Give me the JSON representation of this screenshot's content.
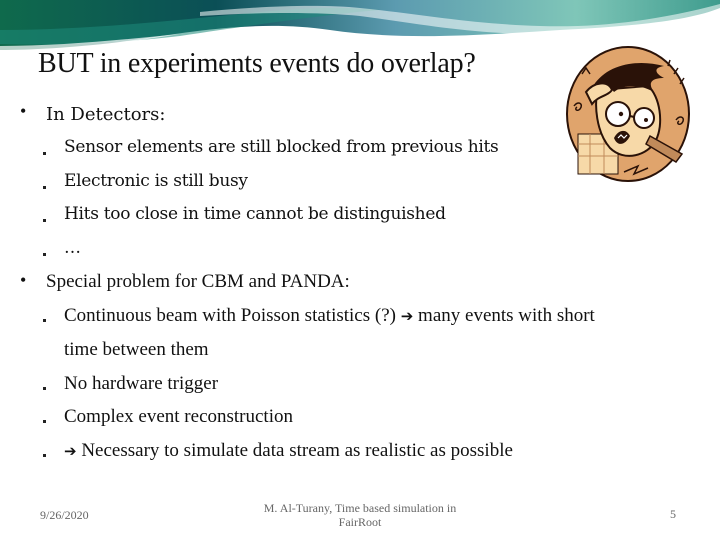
{
  "slide": {
    "title": "BUT in experiments events do overlap?",
    "bullets": [
      {
        "text": "In Detectors:",
        "children": [
          "Sensor elements are still blocked from previous hits",
          "Electronic is still busy",
          "Hits too close in time cannot be distinguished",
          "…"
        ]
      },
      {
        "text": "Special problem for CBM and PANDA:",
        "children": [
          {
            "before_arrow": "Continuous beam with Poisson statistics (?)",
            "arrow": "➔",
            "after_arrow": "many events with short",
            "continuation": "time between them"
          },
          "No hardware trigger",
          "Complex event reconstruction",
          {
            "arrow": "➔",
            "after_arrow": "Necessary to simulate data stream as realistic as possible"
          }
        ]
      }
    ],
    "bullet_glyph": "•",
    "image": "stressed-scientist-cartoon"
  },
  "footer": {
    "date": "9/26/2020",
    "center_line1": "M. Al-Turany, Time based simulation in",
    "center_line2": "FairRoot",
    "page_number": "5"
  },
  "colors": {
    "banner_dark": "#0d5a52",
    "banner_mid": "#2e8c84",
    "banner_light": "#9fd3cc",
    "cartoon_bg": "#e0a46c",
    "cartoon_skin": "#f7d9a8",
    "cartoon_outline": "#2a1208"
  }
}
